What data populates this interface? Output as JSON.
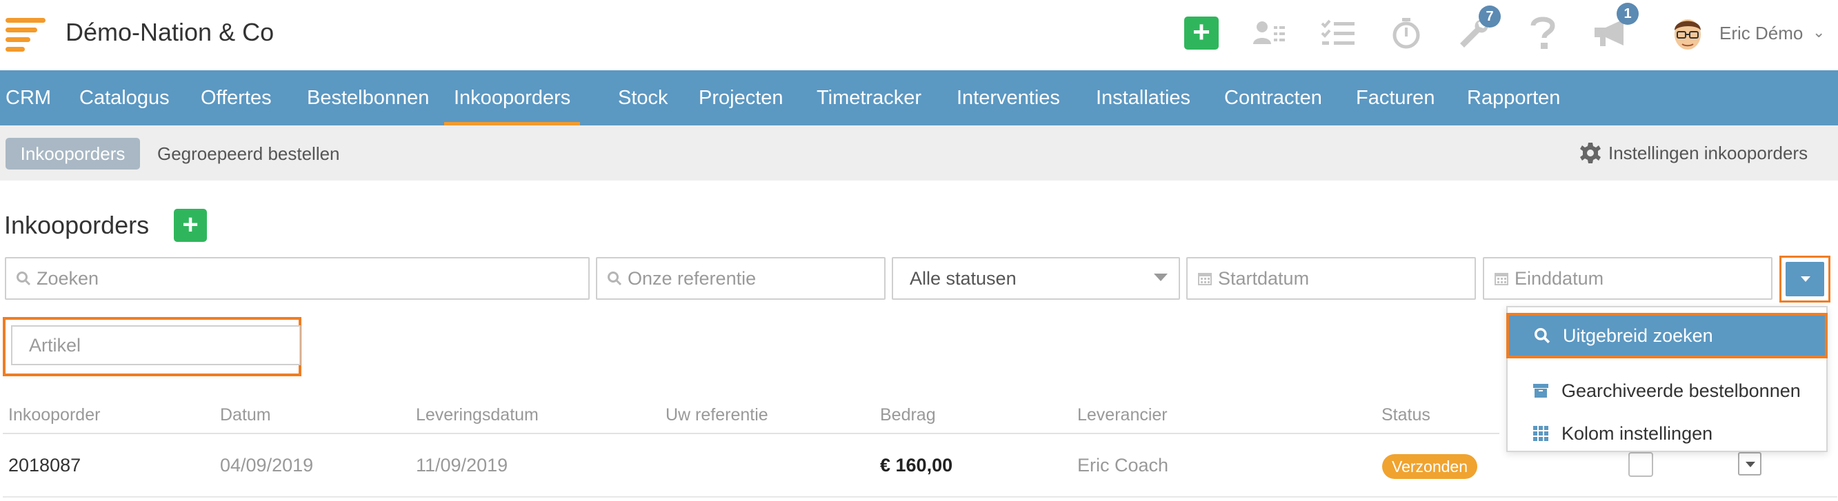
{
  "header": {
    "company_name": "Démo-Nation & Co",
    "user_name": "Eric Démo",
    "tools_badge": "7",
    "announcements_badge": "1",
    "brand_color": "#f39a2c",
    "add_color": "#2fb65c",
    "icons": [
      "menu-logo",
      "plus-icon",
      "contacts-icon",
      "tasks-icon",
      "stopwatch-icon",
      "wrench-icon",
      "help-icon",
      "megaphone-icon",
      "avatar",
      "chevron-down-icon"
    ]
  },
  "nav": {
    "color": "#5b98c2",
    "active_index": 4,
    "items": [
      "CRM",
      "Catalogus",
      "Offertes",
      "Bestelbonnen",
      "Inkooporders",
      "Stock",
      "Projecten",
      "Timetracker",
      "Interventies",
      "Installaties",
      "Contracten",
      "Facturen",
      "Rapporten"
    ]
  },
  "subnav": {
    "active": "Inkooporders",
    "link": "Gegroepeerd bestellen",
    "settings": "Instellingen inkooporders"
  },
  "page": {
    "title": "Inkooporders"
  },
  "filters": {
    "search_placeholder": "Zoeken",
    "reference_placeholder": "Onze referentie",
    "status_value": "Alle statusen",
    "start_placeholder": "Startdatum",
    "end_placeholder": "Einddatum",
    "article_placeholder": "Artikel"
  },
  "menu": {
    "items": [
      {
        "label": "Uitgebreid zoeken",
        "icon": "search-icon"
      },
      {
        "label": "Gearchiveerde bestelbonnen",
        "icon": "archive-icon"
      },
      {
        "label": "Kolom instellingen",
        "icon": "grid-icon"
      }
    ]
  },
  "table": {
    "columns": [
      "Inkooporder",
      "Datum",
      "Leveringsdatum",
      "Uw referentie",
      "Bedrag",
      "Leverancier",
      "Status"
    ],
    "rows": [
      {
        "order": "2018087",
        "date": "04/09/2019",
        "delivery": "11/09/2019",
        "reference": "",
        "amount": "€ 160,00",
        "supplier": "Eric Coach",
        "status": "Verzonden",
        "status_color": "#f0a32f"
      }
    ]
  }
}
